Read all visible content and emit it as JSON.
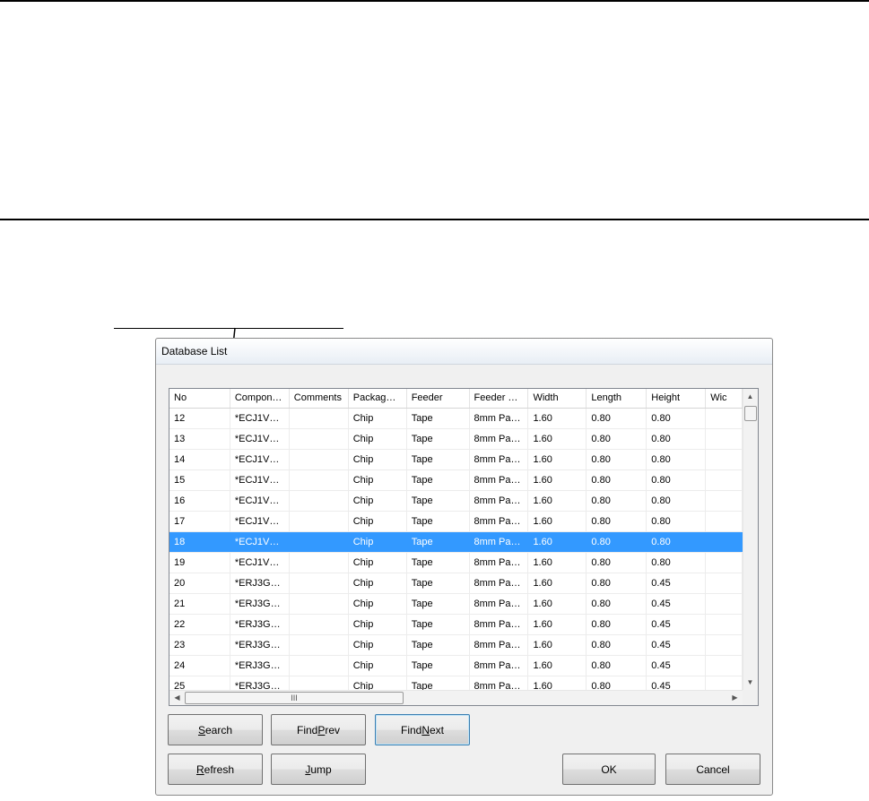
{
  "dialog": {
    "title": "Database List",
    "columns": [
      "No",
      "Compon…",
      "Comments",
      "Packag…",
      "Feeder",
      "Feeder …",
      "Width",
      "Length",
      "Height",
      "Wic"
    ],
    "rows": [
      [
        "12",
        "*ECJ1V…",
        "",
        "Chip",
        "Tape",
        "8mm Pa…",
        "1.60",
        "0.80",
        "0.80"
      ],
      [
        "13",
        "*ECJ1V…",
        "",
        "Chip",
        "Tape",
        "8mm Pa…",
        "1.60",
        "0.80",
        "0.80"
      ],
      [
        "14",
        "*ECJ1V…",
        "",
        "Chip",
        "Tape",
        "8mm Pa…",
        "1.60",
        "0.80",
        "0.80"
      ],
      [
        "15",
        "*ECJ1V…",
        "",
        "Chip",
        "Tape",
        "8mm Pa…",
        "1.60",
        "0.80",
        "0.80"
      ],
      [
        "16",
        "*ECJ1V…",
        "",
        "Chip",
        "Tape",
        "8mm Pa…",
        "1.60",
        "0.80",
        "0.80"
      ],
      [
        "17",
        "*ECJ1V…",
        "",
        "Chip",
        "Tape",
        "8mm Pa…",
        "1.60",
        "0.80",
        "0.80"
      ],
      [
        "18",
        "*ECJ1V…",
        "",
        "Chip",
        "Tape",
        "8mm Pa…",
        "1.60",
        "0.80",
        "0.80"
      ],
      [
        "19",
        "*ECJ1V…",
        "",
        "Chip",
        "Tape",
        "8mm Pa…",
        "1.60",
        "0.80",
        "0.80"
      ],
      [
        "20",
        "*ERJ3G…",
        "",
        "Chip",
        "Tape",
        "8mm Pa…",
        "1.60",
        "0.80",
        "0.45"
      ],
      [
        "21",
        "*ERJ3G…",
        "",
        "Chip",
        "Tape",
        "8mm Pa…",
        "1.60",
        "0.80",
        "0.45"
      ],
      [
        "22",
        "*ERJ3G…",
        "",
        "Chip",
        "Tape",
        "8mm Pa…",
        "1.60",
        "0.80",
        "0.45"
      ],
      [
        "23",
        "*ERJ3G…",
        "",
        "Chip",
        "Tape",
        "8mm Pa…",
        "1.60",
        "0.80",
        "0.45"
      ],
      [
        "24",
        "*ERJ3G…",
        "",
        "Chip",
        "Tape",
        "8mm Pa…",
        "1.60",
        "0.80",
        "0.45"
      ],
      [
        "25",
        "*ERJ3G…",
        "",
        "Chip",
        "Tape",
        "8mm Pa…",
        "1.60",
        "0.80",
        "0.45"
      ]
    ],
    "selected_row_no": "18",
    "selection_color": "#3399ff",
    "scrollbar": {
      "thumb_grip": "III"
    },
    "buttons": {
      "search": {
        "label": "Search",
        "mnemonic": "S"
      },
      "find_prev": {
        "label": "FindPrev",
        "mnemonic": "P"
      },
      "find_next": {
        "label": "FindNext",
        "mnemonic": "N"
      },
      "refresh": {
        "label": "Refresh",
        "mnemonic": "R"
      },
      "jump": {
        "label": "Jump",
        "mnemonic": "J"
      },
      "ok": {
        "label": "OK"
      },
      "cancel": {
        "label": "Cancel"
      }
    }
  },
  "icons": {
    "scroll_up": "up-arrow-icon",
    "scroll_down": "down-arrow-icon",
    "scroll_left": "left-arrow-icon",
    "scroll_right": "right-arrow-icon",
    "callout": "callout-arrow-icon"
  }
}
